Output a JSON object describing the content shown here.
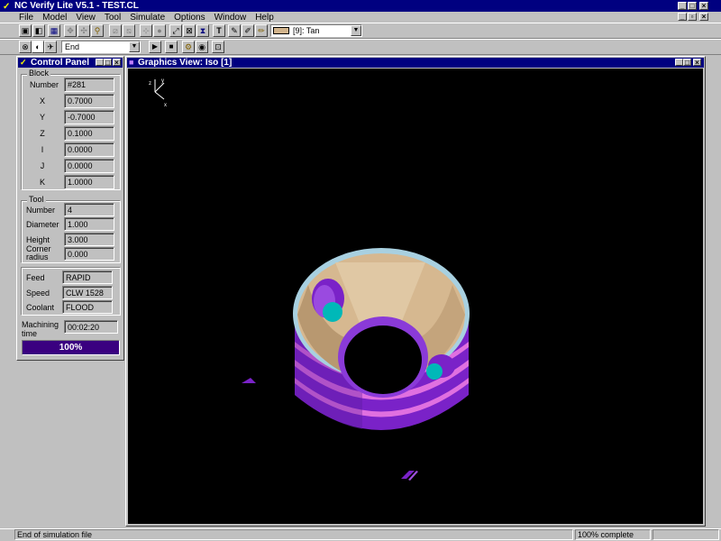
{
  "app": {
    "title": "NC Verify Lite  V5.1  - TEST.CL"
  },
  "menu": [
    "File",
    "Model",
    "View",
    "Tool",
    "Simulate",
    "Options",
    "Window",
    "Help"
  ],
  "toolbar": {
    "color_select": "[9]: Tan",
    "color_swatch": "#d2b48c",
    "mode_select": "End"
  },
  "control_panel": {
    "title": "Control Panel",
    "block": {
      "label": "Block",
      "fields": [
        {
          "label": "Number",
          "value": "#281"
        },
        {
          "label": "X",
          "value": "0.7000"
        },
        {
          "label": "Y",
          "value": "-0.7000"
        },
        {
          "label": "Z",
          "value": "0.1000"
        },
        {
          "label": "I",
          "value": "0.0000"
        },
        {
          "label": "J",
          "value": "0.0000"
        },
        {
          "label": "K",
          "value": "1.0000"
        }
      ]
    },
    "tool": {
      "label": "Tool",
      "fields": [
        {
          "label": "Number",
          "value": "4"
        },
        {
          "label": "Diameter",
          "value": "1.000"
        },
        {
          "label": "Height",
          "value": "3.000"
        },
        {
          "label": "Corner radius",
          "value": "0.000"
        }
      ]
    },
    "feed": {
      "fields": [
        {
          "label": "Feed",
          "value": "RAPID"
        },
        {
          "label": "Speed",
          "value": "CLW 1528"
        },
        {
          "label": "Coolant",
          "value": "FLOOD"
        }
      ]
    },
    "machining_time": {
      "label": "Machining time",
      "value": "00:02:20"
    },
    "progress": {
      "label": "100%",
      "value": 1.0
    }
  },
  "graphics": {
    "title": "Graphics View: Iso [1]",
    "axes": {
      "x": "x",
      "y": "y",
      "z": "z"
    }
  },
  "status": {
    "left": "End of simulation file",
    "right": "100% complete"
  },
  "colors": {
    "titlebar": "#000080",
    "tan": "#d2b48c",
    "purple": "#8a2be2",
    "cyan": "#00c0c0"
  }
}
